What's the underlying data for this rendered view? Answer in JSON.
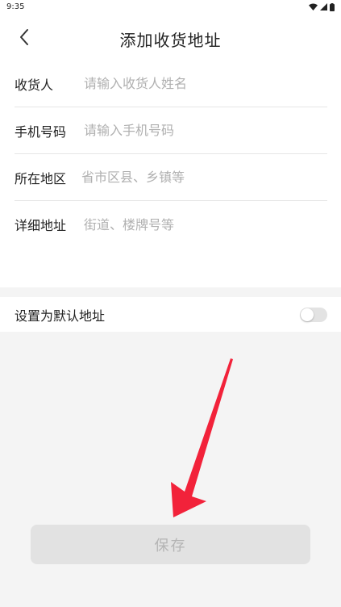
{
  "status_bar": {
    "time": "9:35"
  },
  "header": {
    "title": "添加收货地址",
    "back_icon": "chevron-left-icon"
  },
  "form": {
    "fields": [
      {
        "label": "收货人",
        "placeholder": "请输入收货人姓名",
        "value": ""
      },
      {
        "label": "手机号码",
        "placeholder": "请输入手机号码",
        "value": ""
      },
      {
        "label": "所在地区",
        "placeholder": "省市区县、乡镇等",
        "value": ""
      },
      {
        "label": "详细地址",
        "placeholder": "街道、楼牌号等",
        "value": ""
      }
    ]
  },
  "default_address": {
    "label": "设置为默认地址",
    "enabled": false
  },
  "save_button": {
    "label": "保存"
  },
  "annotation": {
    "arrow_color": "#f2223a"
  }
}
